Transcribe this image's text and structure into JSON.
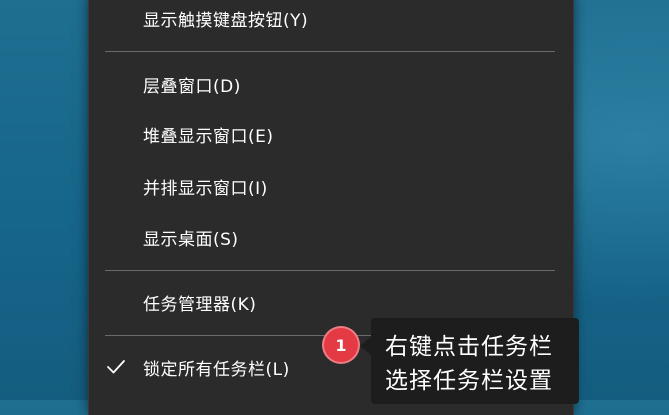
{
  "context_menu": {
    "items": [
      {
        "label": "显示触摸键盘按钮(Y)"
      },
      {
        "label": "层叠窗口(D)"
      },
      {
        "label": "堆叠显示窗口(E)"
      },
      {
        "label": "并排显示窗口(I)"
      },
      {
        "label": "显示桌面(S)"
      },
      {
        "label": "任务管理器(K)"
      },
      {
        "label": "锁定所有任务栏(L)",
        "checked": true
      }
    ]
  },
  "annotation": {
    "badge_number": "1",
    "tooltip_lines": [
      "右键点击任务栏",
      "选择任务栏设置"
    ]
  },
  "colors": {
    "menu_bg": "#2b2b2b",
    "badge": "#e33a44",
    "tooltip_bg": "#1d1d1d",
    "desktop": "#1a6a8c"
  }
}
